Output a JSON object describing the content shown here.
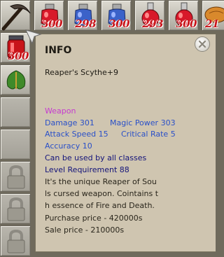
{
  "hotbar": {
    "counts": [
      "300",
      "298",
      "300",
      "293",
      "300",
      "21"
    ],
    "side_count": "300"
  },
  "tooltip": {
    "title": "INFO",
    "item_name": "Reaper's Scythe+9",
    "category": "Weapon",
    "damage": "Damage 301",
    "magic_power": "Magic Power 303",
    "attack_speed": "Attack Speed 15",
    "critical_rate": "Critical Rate 5",
    "accuracy": "Accuracy 10",
    "usable_by": "Can be used by all classes",
    "level_requirement": "Level Requirement 88",
    "desc_line1": "It's the unique Reaper of Sou",
    "desc_line2": "ls cursed weapon. Cointains t",
    "desc_line3": "h essence of Fire and Death.",
    "purchase_price": "Purchase price - 420000s",
    "sale_price": "Sale price - 210000s"
  },
  "colors": {
    "count_red": "#c8141a",
    "stat_blue": "#2a50c8",
    "category_magenta": "#c63ad0",
    "requirement_navy": "#13137a",
    "tooltip_bg": "#cfc5b0"
  },
  "icons": [
    "scythe-icon",
    "red-potion-icon",
    "blue-potion-icon",
    "red-flask-icon",
    "fish-bread-icon",
    "red-jar-icon",
    "leaf-amulet-icon",
    "lock-icon",
    "close-icon"
  ]
}
